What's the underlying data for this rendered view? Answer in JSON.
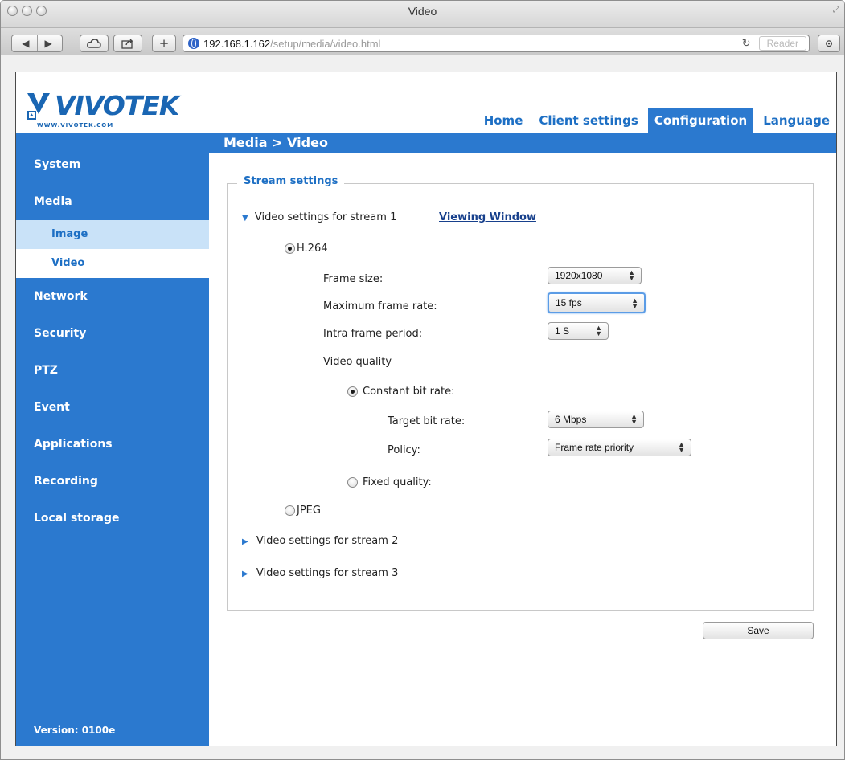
{
  "browser": {
    "window_title": "Video",
    "url_host": "192.168.1.162",
    "url_path": "/setup/media/video.html",
    "reader_label": "Reader"
  },
  "brand": {
    "logo_text": "VIVOTEK",
    "logo_url": "WWW.VIVOTEK.COM",
    "color": "#2b79cf"
  },
  "topnav": [
    {
      "label": "Home",
      "active": false
    },
    {
      "label": "Client settings",
      "active": false
    },
    {
      "label": "Configuration",
      "active": true
    },
    {
      "label": "Language",
      "active": false
    }
  ],
  "breadcrumb": "Media  > Video",
  "sidebar": {
    "items": [
      "System",
      "Media",
      "Network",
      "Security",
      "PTZ",
      "Event",
      "Applications",
      "Recording",
      "Local storage"
    ],
    "media_sub": [
      "Image",
      "Video"
    ],
    "selected_sub": "Video",
    "version": "Version: 0100e"
  },
  "stream_settings": {
    "legend": "Stream settings",
    "stream1": {
      "label": "Video settings for stream 1",
      "expanded": true,
      "viewing_window": "Viewing Window",
      "codec_h264": "H.264",
      "codec_jpeg": "JPEG",
      "selected_codec": "H.264",
      "frame_size": {
        "label": "Frame size:",
        "value": "1920x1080"
      },
      "max_frame_rate": {
        "label": "Maximum frame rate:",
        "value": "15 fps"
      },
      "intra_frame_period": {
        "label": "Intra frame period:",
        "value": "1 S"
      },
      "video_quality": {
        "label": "Video quality",
        "constant_bit_rate": "Constant bit rate:",
        "target_bit_rate": {
          "label": "Target bit rate:",
          "value": "6 Mbps"
        },
        "policy": {
          "label": "Policy:",
          "value": "Frame rate priority"
        },
        "fixed_quality": "Fixed quality:",
        "selected": "Constant bit rate"
      }
    },
    "stream2": {
      "label": "Video settings for stream 2",
      "expanded": false
    },
    "stream3": {
      "label": "Video settings for stream 3",
      "expanded": false
    }
  },
  "save_label": "Save"
}
